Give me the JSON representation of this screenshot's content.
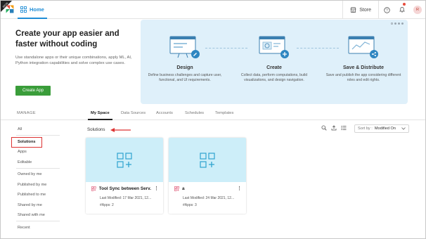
{
  "topbar": {
    "beta_label": "BETA",
    "home_label": "Home",
    "store_label": "Store",
    "avatar_initials": "R"
  },
  "hero": {
    "title_line1": "Create your app easier and",
    "title_line2": "faster without coding",
    "description": "Use standalone apps or their unique combinations, apply ML, AI, Python integration capabilities and solve complex use cases.",
    "cta_label": "Create App",
    "features": [
      {
        "title": "Design",
        "description": "Define business challenges and capture user, functional, and UI requirements.",
        "icon": "design-illustration-icon"
      },
      {
        "title": "Create",
        "description": "Collect data, perform computations, build visualizations, and design navigation.",
        "icon": "create-illustration-icon"
      },
      {
        "title": "Save & Distribute",
        "description": "Save and publish the app considering different roles and edit rights.",
        "icon": "share-illustration-icon"
      }
    ]
  },
  "tabs": {
    "manage_label": "MANAGE",
    "items": [
      "My Space",
      "Data Sources",
      "Accounts",
      "Schedules",
      "Templates"
    ],
    "active": "My Space"
  },
  "sidebar": {
    "items": [
      "All",
      "Solutions",
      "Apps",
      "Editable",
      "Owned by me",
      "Published by me",
      "Published to me",
      "Shared by me",
      "Shared with me",
      "Recent"
    ],
    "active": "Solutions"
  },
  "content": {
    "section_label": "Solutions",
    "sort_label": "Sort by :",
    "sort_value": "Modified On",
    "cards": [
      {
        "name": "Tool Sync between Serv...",
        "modified": "Last Modified: 17 Mar 2021, 12...",
        "apps": "#Apps: 2"
      },
      {
        "name": "a",
        "modified": "Last Modified: 24 Mar 2021, 12...",
        "apps": "#Apps: 3"
      }
    ]
  },
  "colors": {
    "accent_blue": "#1f8dd6",
    "cta_green": "#3a9d3a",
    "hero_panel": "#dff0fa",
    "card_thumb": "#cdeef9",
    "highlight_red": "#d33"
  }
}
